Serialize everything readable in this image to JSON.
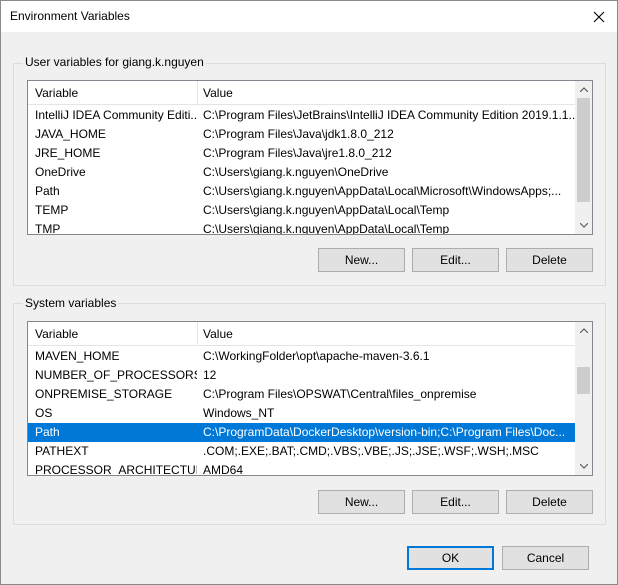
{
  "window": {
    "title": "Environment Variables",
    "close_icon": "close-icon"
  },
  "user": {
    "group_label": "User variables for giang.k.nguyen",
    "columns": [
      "Variable",
      "Value"
    ],
    "rows": [
      {
        "variable": "IntelliJ IDEA Community Editi...",
        "value": "C:\\Program Files\\JetBrains\\IntelliJ IDEA Community Edition 2019.1.1..."
      },
      {
        "variable": "JAVA_HOME",
        "value": "C:\\Program Files\\Java\\jdk1.8.0_212"
      },
      {
        "variable": "JRE_HOME",
        "value": "C:\\Program Files\\Java\\jre1.8.0_212"
      },
      {
        "variable": "OneDrive",
        "value": "C:\\Users\\giang.k.nguyen\\OneDrive"
      },
      {
        "variable": "Path",
        "value": "C:\\Users\\giang.k.nguyen\\AppData\\Local\\Microsoft\\WindowsApps;..."
      },
      {
        "variable": "TEMP",
        "value": "C:\\Users\\giang.k.nguyen\\AppData\\Local\\Temp"
      },
      {
        "variable": "TMP",
        "value": "C:\\Users\\giang.k.nguyen\\AppData\\Local\\Temp"
      }
    ],
    "buttons": {
      "new": "New...",
      "edit": "Edit...",
      "delete": "Delete"
    }
  },
  "system": {
    "group_label": "System variables",
    "columns": [
      "Variable",
      "Value"
    ],
    "rows": [
      {
        "variable": "MAVEN_HOME",
        "value": "C:\\WorkingFolder\\opt\\apache-maven-3.6.1"
      },
      {
        "variable": "NUMBER_OF_PROCESSORS",
        "value": "12"
      },
      {
        "variable": "ONPREMISE_STORAGE",
        "value": "C:\\Program Files\\OPSWAT\\Central\\files_onpremise"
      },
      {
        "variable": "OS",
        "value": "Windows_NT"
      },
      {
        "variable": "Path",
        "value": "C:\\ProgramData\\DockerDesktop\\version-bin;C:\\Program Files\\Doc...",
        "selected": true
      },
      {
        "variable": "PATHEXT",
        "value": ".COM;.EXE;.BAT;.CMD;.VBS;.VBE;.JS;.JSE;.WSF;.WSH;.MSC"
      },
      {
        "variable": "PROCESSOR_ARCHITECTURE",
        "value": "AMD64"
      }
    ],
    "buttons": {
      "new": "New...",
      "edit": "Edit...",
      "delete": "Delete"
    }
  },
  "footer": {
    "ok": "OK",
    "cancel": "Cancel"
  },
  "colors": {
    "selection": "#0078d7",
    "default_button_border": "#0078d7"
  }
}
